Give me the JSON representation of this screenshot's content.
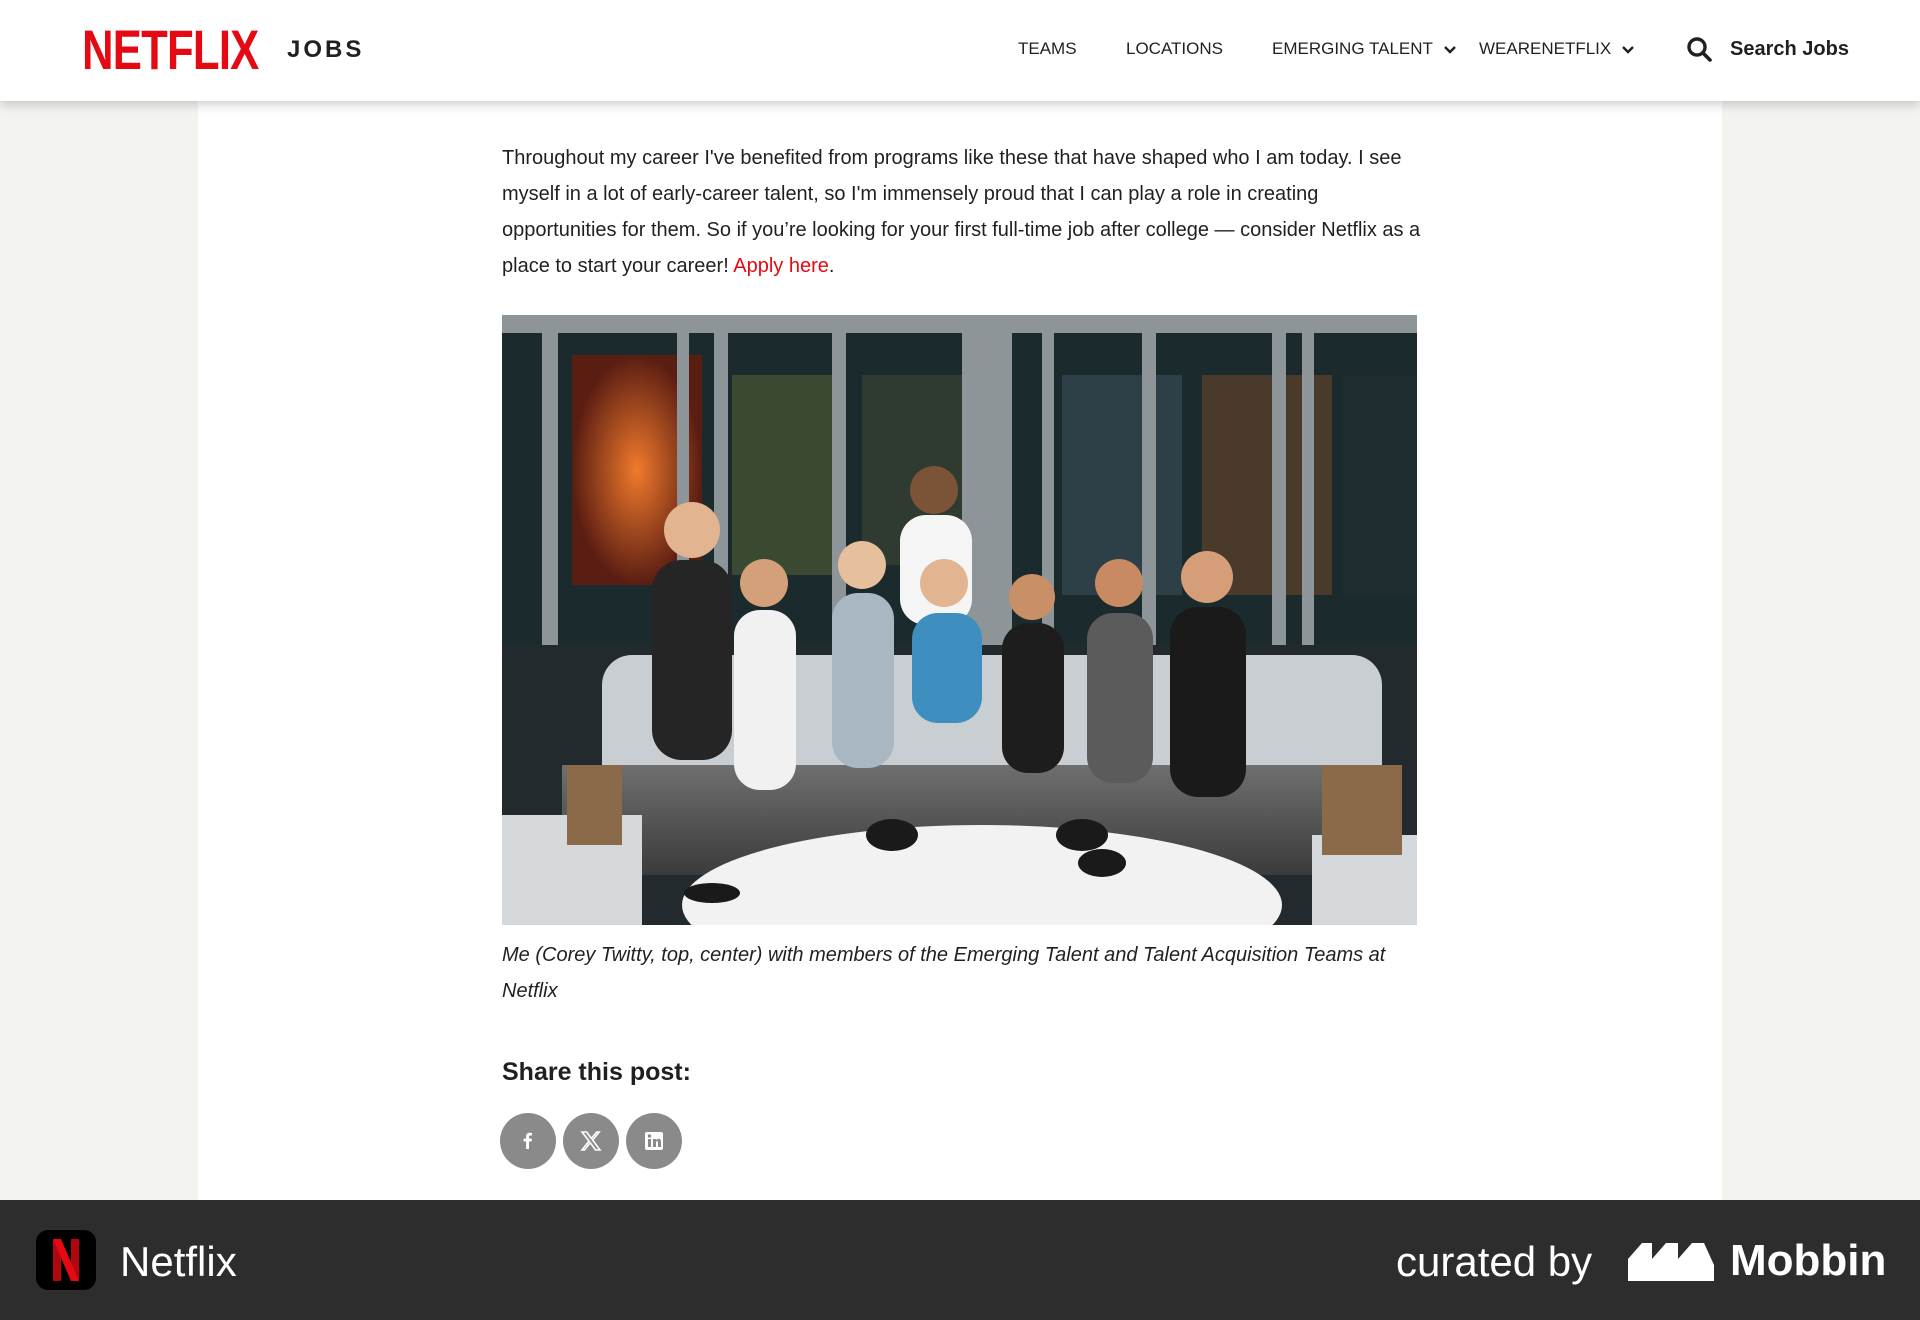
{
  "header": {
    "logo": "NETFLIX",
    "logo_suffix": "JOBS",
    "nav": [
      {
        "label": "TEAMS"
      },
      {
        "label": "LOCATIONS"
      },
      {
        "label": "EMERGING TALENT"
      },
      {
        "label": "WEARENETFLIX"
      }
    ],
    "search_label": "Search Jobs"
  },
  "article": {
    "paragraph": "Throughout my career I've benefited from programs like these that have shaped who I am today. I see myself in a lot of early-career talent, so I'm immensely proud that I can play a role in creating opportunities for them. So if you’re looking for your first full-time job after college — consider Netflix as a place to start your career!",
    "apply_link": "Apply here",
    "apply_suffix": ".",
    "caption": "Me (Corey Twitty, top, center) with members of the Emerging Talent and Talent Acquisition Teams at Netflix",
    "share_title": "Share this post:"
  },
  "footer": {
    "app_name": "Netflix",
    "curated_by": "curated by",
    "brand": "Mobbin"
  },
  "colors": {
    "brand_red": "#e50914",
    "footer_bg": "#2d2d2d",
    "share_button": "#8a8a8a"
  }
}
